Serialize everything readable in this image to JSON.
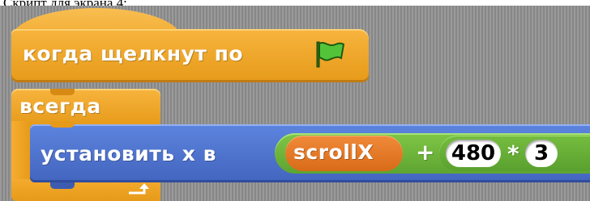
{
  "caption": "Скрипт для экрана 4:",
  "hat_block": {
    "label": "когда щелкнут по",
    "icon": "green-flag-icon"
  },
  "forever_block": {
    "label": "всегда",
    "loop_icon": "loop-arrow-icon"
  },
  "set_block": {
    "label": "установить x в",
    "expression": {
      "variable": "scrollX",
      "plus_operator": "+",
      "operand": "480",
      "times_operator": "*",
      "multiplier": "3"
    }
  },
  "colors": {
    "control": "#e69a19",
    "motion": "#4a6cd4",
    "operators": "#62a834",
    "variables": "#ee7d16",
    "background": "#8f8f8f"
  }
}
